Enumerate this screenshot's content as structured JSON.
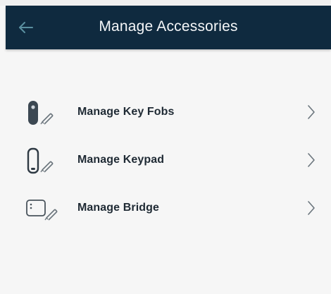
{
  "header": {
    "title": "Manage Accessories"
  },
  "icons": {
    "back": "back-arrow-icon",
    "key_fob": "key-fob-icon",
    "keypad": "keypad-icon",
    "bridge": "bridge-icon",
    "chevron": "chevron-right-icon",
    "pencil": "pencil-icon"
  },
  "colors": {
    "header_bg": "#0f2a3f",
    "back_arrow": "#5a8fa0",
    "text": "#1f2a34",
    "background": "#f6f6f6"
  },
  "menu": {
    "items": [
      {
        "label": "Manage Key Fobs"
      },
      {
        "label": "Manage Keypad"
      },
      {
        "label": "Manage Bridge"
      }
    ]
  }
}
